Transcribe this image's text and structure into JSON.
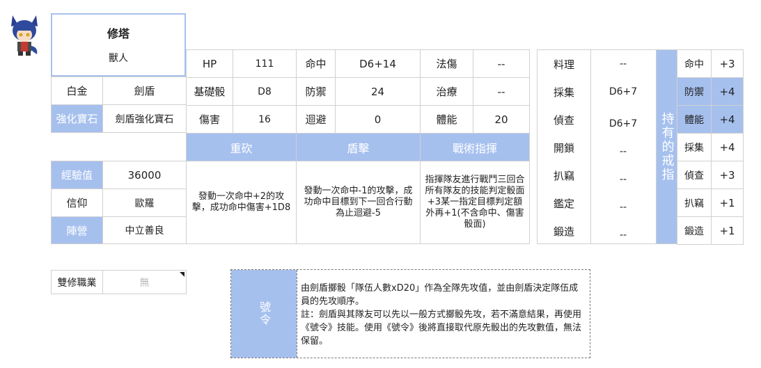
{
  "profile": {
    "name": "修塔",
    "race": "獸人",
    "rank": "白金",
    "class_name": "劍盾",
    "gem_label": "強化寶石",
    "gem_value": "劍盾強化寶石",
    "exp_label": "經驗值",
    "exp_value": "36000",
    "faith_label": "信仰",
    "faith_value": "歐羅",
    "align_label": "陣營",
    "align_value": "中立善良"
  },
  "stats": {
    "hp_label": "HP",
    "hp_value": "111",
    "hit_label": "命中",
    "hit_value": "D6+14",
    "magic_label": "法傷",
    "magic_value": "--",
    "base_dice_label": "基礎骰",
    "base_dice_value": "D8",
    "defense_label": "防禦",
    "defense_value": "24",
    "heal_label": "治療",
    "heal_value": "--",
    "damage_label": "傷害",
    "damage_value": "16",
    "dodge_label": "迴避",
    "dodge_value": "0",
    "stamina_label": "體能",
    "stamina_value": "20"
  },
  "skills": [
    {
      "name": "重砍",
      "desc": "發動一次命中+2的攻擊，成功命中傷害+1D8"
    },
    {
      "name": "盾擊",
      "desc": "發動一次命中-1的攻擊，成功命中目標到下一回合行動為止迴避-5"
    },
    {
      "name": "戰術指揮",
      "desc": "指揮隊友進行戰鬥三回合所有隊友的技能判定骰面+3某一指定目標判定額外再+1(不含命中、傷害骰面)"
    }
  ],
  "life_skills": [
    {
      "label": "料理",
      "value": "--"
    },
    {
      "label": "採集",
      "value": "D6+7"
    },
    {
      "label": "偵查",
      "value": "D6+7"
    },
    {
      "label": "開鎖",
      "value": "--"
    },
    {
      "label": "扒竊",
      "value": "--"
    },
    {
      "label": "鑑定",
      "value": "--"
    },
    {
      "label": "鍛造",
      "value": "--"
    }
  ],
  "rings": {
    "header": "持有的戒指",
    "items": [
      {
        "label": "命中",
        "value": "+3",
        "highlight": false
      },
      {
        "label": "防禦",
        "value": "+4",
        "highlight": true
      },
      {
        "label": "體能",
        "value": "+4",
        "highlight": true
      },
      {
        "label": "採集",
        "value": "+4",
        "highlight": false
      },
      {
        "label": "偵查",
        "value": "+3",
        "highlight": false
      },
      {
        "label": "扒竊",
        "value": "+1",
        "highlight": false
      },
      {
        "label": "鍛造",
        "value": "+1",
        "highlight": false
      }
    ]
  },
  "dual_class": {
    "label": "雙修職業",
    "value": "無"
  },
  "command": {
    "title": "號令",
    "text": "由劍盾擲骰「隊伍人數xD20」作為全隊先攻值，並由劍盾決定隊伍成員的先攻順序。\n註：劍盾與其隊友可以先以一般方式擲骰先攻，若不滿意結果，再使用《號令》技能。使用《號令》後將直接取代原先骰出的先攻數值，無法保留。"
  },
  "colors": {
    "accent": "#a6c0ee",
    "border": "#d0d0d0",
    "name_border": "#a6c0ee"
  },
  "avatar_icon": "wolf-boy-avatar-icon"
}
